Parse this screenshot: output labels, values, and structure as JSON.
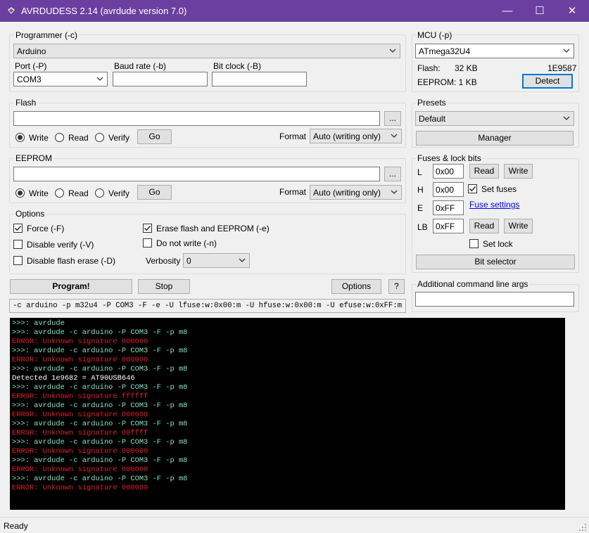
{
  "window": {
    "title": "AVRDUDESS 2.14 (avrdude version 7.0)",
    "controls": {
      "minimize": "—",
      "maximize": "☐",
      "close": "✕"
    }
  },
  "programmer": {
    "group_label": "Programmer (-c)",
    "selected": "Arduino",
    "port_label": "Port (-P)",
    "port_value": "COM3",
    "baud_label": "Baud rate (-b)",
    "baud_value": "",
    "bitclock_label": "Bit clock (-B)",
    "bitclock_value": ""
  },
  "flash": {
    "group_label": "Flash",
    "path": "",
    "browse_label": "...",
    "write_label": "Write",
    "read_label": "Read",
    "verify_label": "Verify",
    "go_label": "Go",
    "format_label": "Format",
    "format_value": "Auto (writing only)",
    "selected_op": "write"
  },
  "eeprom": {
    "group_label": "EEPROM",
    "path": "",
    "browse_label": "...",
    "write_label": "Write",
    "read_label": "Read",
    "verify_label": "Verify",
    "go_label": "Go",
    "format_label": "Format",
    "format_value": "Auto (writing only)",
    "selected_op": "write"
  },
  "options": {
    "group_label": "Options",
    "force_label": "Force (-F)",
    "force_checked": true,
    "disable_verify_label": "Disable verify (-V)",
    "disable_verify_checked": false,
    "disable_flash_erase_label": "Disable flash erase (-D)",
    "disable_flash_erase_checked": false,
    "erase_label": "Erase flash and EEPROM (-e)",
    "erase_checked": true,
    "no_write_label": "Do not write (-n)",
    "no_write_checked": false,
    "verbosity_label": "Verbosity",
    "verbosity_value": "0"
  },
  "actions": {
    "program_label": "Program!",
    "stop_label": "Stop",
    "options_label": "Options",
    "help_label": "?"
  },
  "command_line": "-c arduino -p m32u4 -P COM3 -F -e -U lfuse:w:0x00:m -U hfuse:w:0x00:m -U efuse:w:0xFF:m",
  "mcu": {
    "group_label": "MCU (-p)",
    "selected": "ATmega32U4",
    "flash_label": "Flash:",
    "flash_value": "32 KB",
    "signature": "1E9587",
    "eeprom_text": "EEPROM: 1 KB",
    "detect_label": "Detect"
  },
  "presets": {
    "group_label": "Presets",
    "selected": "Default",
    "manager_label": "Manager"
  },
  "fuses": {
    "group_label": "Fuses & lock bits",
    "l_label": "L",
    "l_value": "0x00",
    "h_label": "H",
    "h_value": "0x00",
    "e_label": "E",
    "e_value": "0xFF",
    "lb_label": "LB",
    "lb_value": "0xFF",
    "read_label": "Read",
    "write_label": "Write",
    "set_fuses_label": "Set fuses",
    "set_fuses_checked": true,
    "fuse_settings_link": "Fuse settings",
    "set_lock_label": "Set lock",
    "set_lock_checked": false,
    "bit_selector_label": "Bit selector"
  },
  "additional_args": {
    "group_label": "Additional command line args",
    "value": ""
  },
  "console": {
    "lines": [
      {
        "type": "cmd",
        "text": ">>>: avrdude"
      },
      {
        "type": "cmd",
        "text": ">>>: avrdude -c arduino -P COM3 -F -p m8"
      },
      {
        "type": "err",
        "text": "ERROR: Unknown signature 000000"
      },
      {
        "type": "cmd",
        "text": ">>>: avrdude -c arduino -P COM3 -F -p m8"
      },
      {
        "type": "err",
        "text": "ERROR: Unknown signature 000000"
      },
      {
        "type": "cmd",
        "text": ">>>: avrdude -c arduino -P COM3 -F -p m8"
      },
      {
        "type": "inf",
        "text": "Detected 1e9682 = AT90USB646"
      },
      {
        "type": "cmd",
        "text": ">>>: avrdude -c arduino -P COM3 -F -p m8"
      },
      {
        "type": "err",
        "text": "ERROR: Unknown signature ffffff"
      },
      {
        "type": "cmd",
        "text": ">>>: avrdude -c arduino -P COM3 -F -p m8"
      },
      {
        "type": "err",
        "text": "ERROR: Unknown signature 000000"
      },
      {
        "type": "cmd",
        "text": ">>>: avrdude -c arduino -P COM3 -F -p m8"
      },
      {
        "type": "err",
        "text": "ERROR: Unknown signature 00ffff"
      },
      {
        "type": "cmd",
        "text": ">>>: avrdude -c arduino -P COM3 -F -p m8"
      },
      {
        "type": "err",
        "text": "ERROR: Unknown signature 000000"
      },
      {
        "type": "cmd",
        "text": ">>>: avrdude -c arduino -P COM3 -F -p m8"
      },
      {
        "type": "err",
        "text": "ERROR: Unknown signature 000000"
      },
      {
        "type": "cmd",
        "text": ">>>: avrdude -c arduino -P COM3 -F -p m8"
      },
      {
        "type": "err",
        "text": "ERROR: Unknown signature 000000"
      }
    ]
  },
  "status": {
    "text": "Ready"
  },
  "colors": {
    "titlebar": "#6b3fa0",
    "console_bg": "#000000",
    "cmd_text": "#86e0c0",
    "error_text": "#e0202a",
    "link": "#0000ee"
  }
}
